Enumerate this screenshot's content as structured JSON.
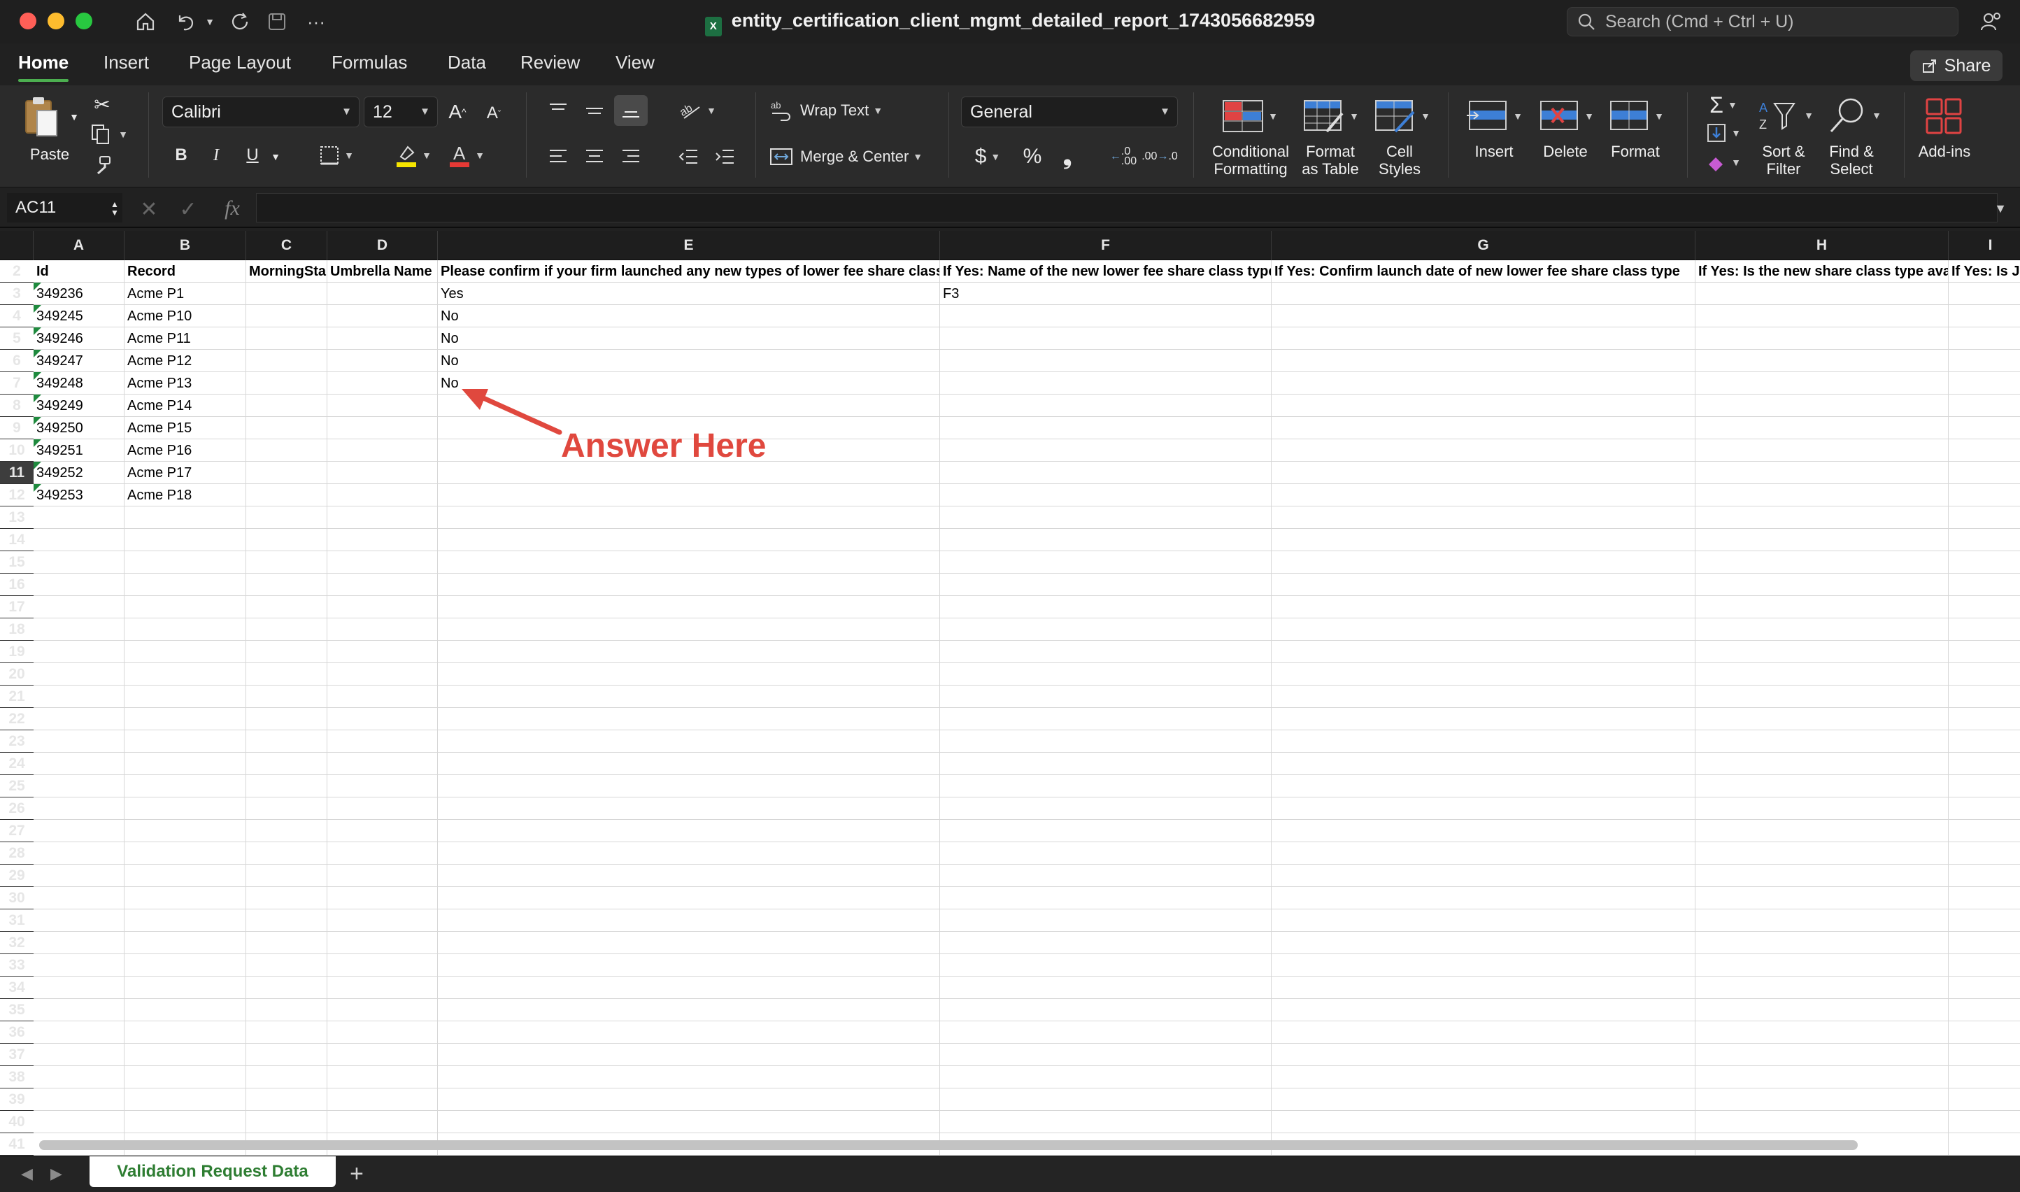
{
  "window": {
    "title": "entity_certification_client_mgmt_detailed_report_1743056682959",
    "search_placeholder": "Search (Cmd + Ctrl + U)"
  },
  "tabs": [
    "Home",
    "Insert",
    "Page Layout",
    "Formulas",
    "Data",
    "Review",
    "View"
  ],
  "active_tab": "Home",
  "share_label": "Share",
  "ribbon": {
    "paste": "Paste",
    "font_name": "Calibri",
    "font_size": "12",
    "bold": "B",
    "italic": "I",
    "underline": "U",
    "wrap_text": "Wrap Text",
    "merge_center": "Merge & Center",
    "number_format": "General",
    "conditional_formatting": [
      "Conditional",
      "Formatting"
    ],
    "format_as_table": [
      "Format",
      "as Table"
    ],
    "cell_styles": [
      "Cell",
      "Styles"
    ],
    "insert": "Insert",
    "delete": "Delete",
    "format": "Format",
    "sort_filter": [
      "Sort &",
      "Filter"
    ],
    "find_select": [
      "Find &",
      "Select"
    ],
    "add_ins": "Add-ins"
  },
  "formula_bar": {
    "name_box": "AC11",
    "fx": "fx",
    "value": ""
  },
  "columns": [
    "A",
    "B",
    "C",
    "D",
    "E",
    "F",
    "G",
    "H",
    "I"
  ],
  "row_numbers": [
    "2",
    "3",
    "4",
    "5",
    "6",
    "7",
    "8",
    "9",
    "10",
    "11",
    "12",
    "13",
    "14",
    "15",
    "16",
    "17",
    "18",
    "19",
    "20",
    "21",
    "22",
    "23",
    "24",
    "25",
    "26",
    "27",
    "28",
    "29",
    "30",
    "31",
    "32",
    "33",
    "34",
    "35",
    "36",
    "37",
    "38",
    "39",
    "40",
    "41"
  ],
  "selected_row": "11",
  "headers": [
    "Id",
    "Record",
    "MorningStar",
    "Umbrella Name",
    "Please confirm if your firm launched any new types of lower fee share classes",
    "If Yes: Name of the new lower fee share class type",
    "If Yes: Confirm launch date of new lower fee share class type",
    "If Yes: Is the new share class type available",
    "If Yes: Is J"
  ],
  "rows": [
    {
      "id": "349236",
      "record": "Acme P1",
      "e": "Yes",
      "f": "F3"
    },
    {
      "id": "349245",
      "record": "Acme P10",
      "e": "No",
      "f": ""
    },
    {
      "id": "349246",
      "record": "Acme P11",
      "e": "No",
      "f": ""
    },
    {
      "id": "349247",
      "record": "Acme P12",
      "e": "No",
      "f": ""
    },
    {
      "id": "349248",
      "record": "Acme P13",
      "e": "No",
      "f": ""
    },
    {
      "id": "349249",
      "record": "Acme P14",
      "e": "",
      "f": ""
    },
    {
      "id": "349250",
      "record": "Acme P15",
      "e": "",
      "f": ""
    },
    {
      "id": "349251",
      "record": "Acme P16",
      "e": "",
      "f": ""
    },
    {
      "id": "349252",
      "record": "Acme P17",
      "e": "",
      "f": ""
    },
    {
      "id": "349253",
      "record": "Acme P18",
      "e": "",
      "f": ""
    }
  ],
  "annotation": {
    "text": "Answer Here",
    "color": "#e0483e"
  },
  "sheets": [
    "Validation Request Data"
  ],
  "colors": {
    "accent_green": "#4caf50",
    "sheet_tab_text": "#2e7d32",
    "comment_flag": "#1f8a3e"
  }
}
